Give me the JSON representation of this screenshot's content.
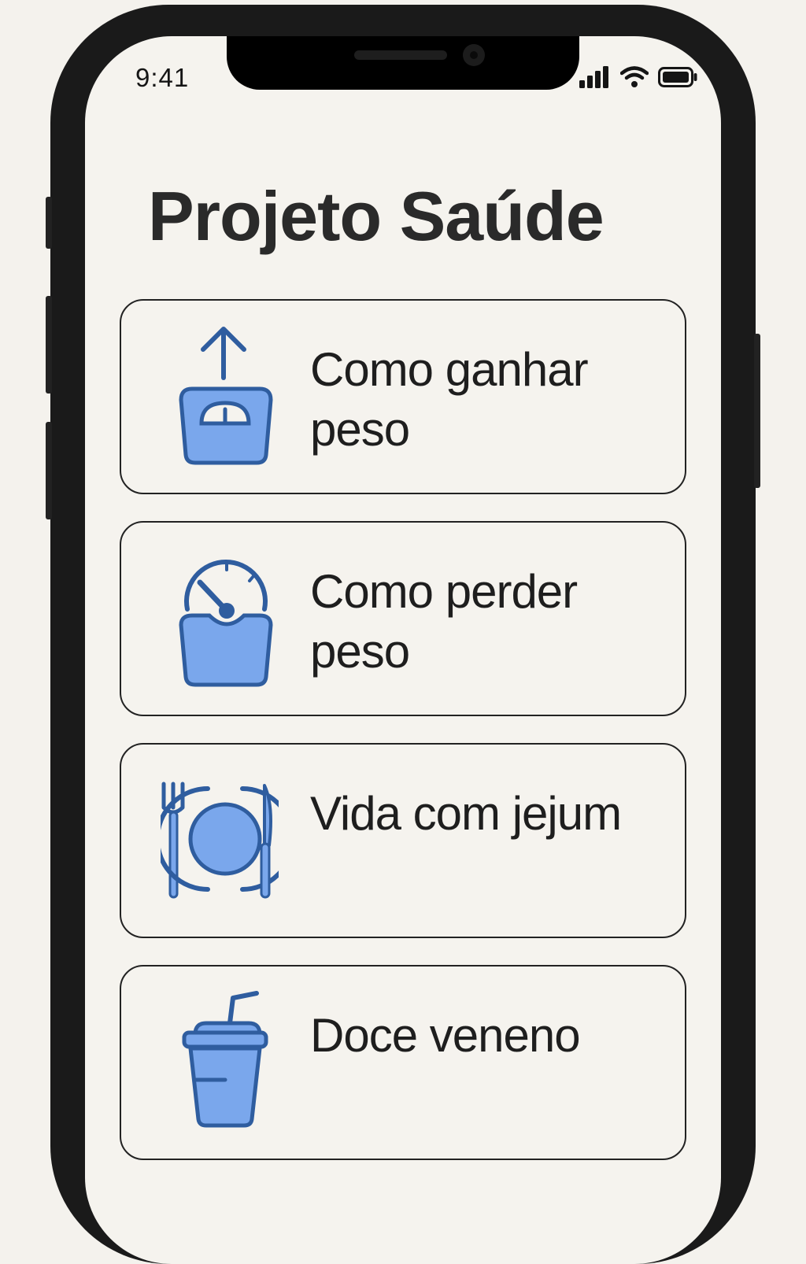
{
  "status_bar": {
    "time": "9:41",
    "icons": [
      "cellular-signal-icon",
      "wifi-icon",
      "battery-icon"
    ]
  },
  "app": {
    "title": "Projeto Saúde"
  },
  "menu": {
    "items": [
      {
        "label": "Como ganhar peso",
        "icon": "scale-arrow-up-icon"
      },
      {
        "label": "Como perder peso",
        "icon": "scale-gauge-icon"
      },
      {
        "label": "Vida com jejum",
        "icon": "plate-fork-knife-icon"
      },
      {
        "label": "Doce veneno",
        "icon": "soda-cup-icon"
      }
    ]
  },
  "colors": {
    "icon_fill": "#7aa7ec",
    "icon_stroke": "#2f5d9f",
    "text": "#1e1e1e",
    "background": "#f5f3ee"
  }
}
